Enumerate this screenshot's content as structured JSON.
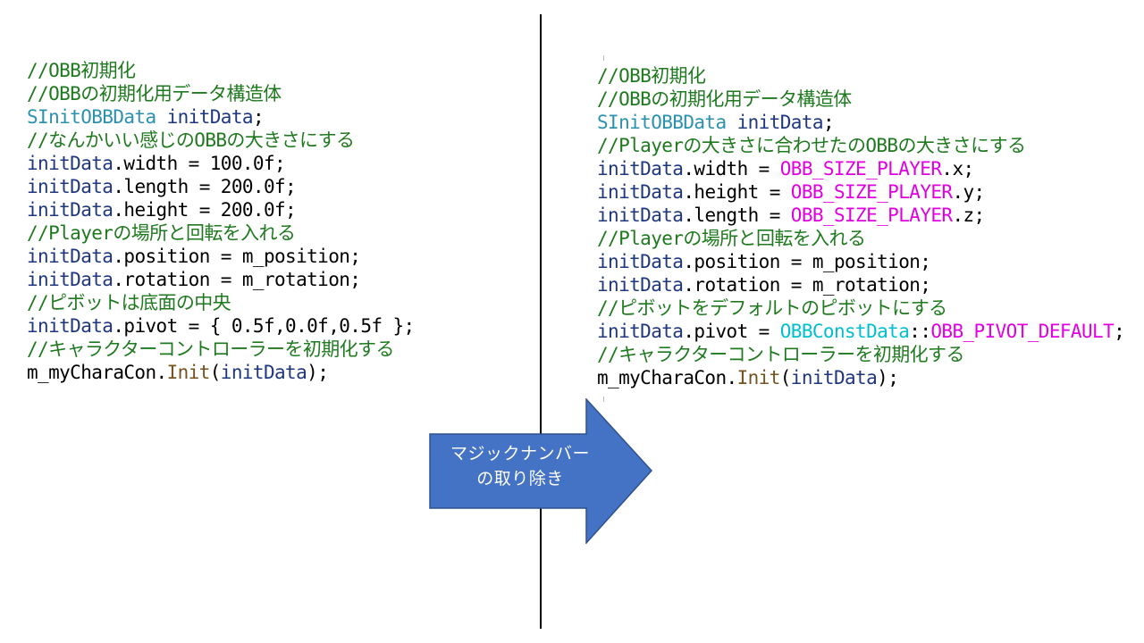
{
  "colors": {
    "comment": "#1f7a1f",
    "type": "#2b91af",
    "variable": "#1f377f",
    "macro": "#e000e0",
    "function": "#74531f",
    "namespace": "#00c0d0",
    "arrow_fill": "#4472c4",
    "arrow_stroke": "#2f528f",
    "divider": "#000000"
  },
  "arrow": {
    "line1": "マジックナンバー",
    "line2": "の取り除き"
  },
  "left": {
    "lines": [
      [
        {
          "t": "//OBB初期化",
          "c": "comment"
        }
      ],
      [
        {
          "t": "//OBBの初期化用データ構造体",
          "c": "comment"
        }
      ],
      [
        {
          "t": "SInitOBBData",
          "c": "type"
        },
        {
          "t": " ",
          "c": "plain"
        },
        {
          "t": "initData",
          "c": "var"
        },
        {
          "t": ";",
          "c": "plain"
        }
      ],
      [
        {
          "t": "//なんかいい感じのOBBの大きさにする",
          "c": "comment"
        }
      ],
      [
        {
          "t": "initData",
          "c": "var"
        },
        {
          "t": ".width = 100.0f;",
          "c": "plain"
        }
      ],
      [
        {
          "t": "initData",
          "c": "var"
        },
        {
          "t": ".length = 200.0f;",
          "c": "plain"
        }
      ],
      [
        {
          "t": "initData",
          "c": "var"
        },
        {
          "t": ".height = 200.0f;",
          "c": "plain"
        }
      ],
      [
        {
          "t": "//Playerの場所と回転を入れる",
          "c": "comment"
        }
      ],
      [
        {
          "t": "initData",
          "c": "var"
        },
        {
          "t": ".position = m_position;",
          "c": "plain"
        }
      ],
      [
        {
          "t": "initData",
          "c": "var"
        },
        {
          "t": ".rotation = m_rotation;",
          "c": "plain"
        }
      ],
      [
        {
          "t": "//ピボットは底面の中央",
          "c": "comment"
        }
      ],
      [
        {
          "t": "initData",
          "c": "var"
        },
        {
          "t": ".pivot = { 0.5f,0.0f,0.5f };",
          "c": "plain"
        }
      ],
      [
        {
          "t": "//キャラクターコントローラーを初期化する",
          "c": "comment"
        }
      ],
      [
        {
          "t": "m_myCharaCon.",
          "c": "plain"
        },
        {
          "t": "Init",
          "c": "func"
        },
        {
          "t": "(",
          "c": "plain"
        },
        {
          "t": "initData",
          "c": "var"
        },
        {
          "t": ");",
          "c": "plain"
        }
      ]
    ]
  },
  "right": {
    "lines": [
      [
        {
          "t": "//OBB初期化",
          "c": "comment"
        }
      ],
      [
        {
          "t": "//OBBの初期化用データ構造体",
          "c": "comment"
        }
      ],
      [
        {
          "t": "SInitOBBData",
          "c": "type"
        },
        {
          "t": " ",
          "c": "plain"
        },
        {
          "t": "initData",
          "c": "var"
        },
        {
          "t": ";",
          "c": "plain"
        }
      ],
      [
        {
          "t": "//Playerの大きさに合わせたのOBBの大きさにする",
          "c": "comment"
        }
      ],
      [
        {
          "t": "initData",
          "c": "var"
        },
        {
          "t": ".width = ",
          "c": "plain"
        },
        {
          "t": "OBB_SIZE_PLAYER",
          "c": "macro"
        },
        {
          "t": ".x;",
          "c": "plain"
        }
      ],
      [
        {
          "t": "initData",
          "c": "var"
        },
        {
          "t": ".height = ",
          "c": "plain"
        },
        {
          "t": "OBB_SIZE_PLAYER",
          "c": "macro"
        },
        {
          "t": ".y;",
          "c": "plain"
        }
      ],
      [
        {
          "t": "initData",
          "c": "var"
        },
        {
          "t": ".length = ",
          "c": "plain"
        },
        {
          "t": "OBB_SIZE_PLAYER",
          "c": "macro"
        },
        {
          "t": ".z;",
          "c": "plain"
        }
      ],
      [
        {
          "t": "//Playerの場所と回転を入れる",
          "c": "comment"
        }
      ],
      [
        {
          "t": "initData",
          "c": "var"
        },
        {
          "t": ".position = m_position;",
          "c": "plain"
        }
      ],
      [
        {
          "t": "initData",
          "c": "var"
        },
        {
          "t": ".rotation = m_rotation;",
          "c": "plain"
        }
      ],
      [
        {
          "t": "//ピボットをデフォルトのピボットにする",
          "c": "comment"
        }
      ],
      [
        {
          "t": "initData",
          "c": "var"
        },
        {
          "t": ".pivot = ",
          "c": "plain"
        },
        {
          "t": "OBBConstData",
          "c": "ns"
        },
        {
          "t": "::",
          "c": "plain"
        },
        {
          "t": "OBB_PIVOT_DEFAULT",
          "c": "macro"
        },
        {
          "t": ";",
          "c": "plain"
        }
      ],
      [
        {
          "t": "//キャラクターコントローラーを初期化する",
          "c": "comment"
        }
      ],
      [
        {
          "t": "m_myCharaCon.",
          "c": "plain"
        },
        {
          "t": "Init",
          "c": "func"
        },
        {
          "t": "(",
          "c": "plain"
        },
        {
          "t": "initData",
          "c": "var"
        },
        {
          "t": ");",
          "c": "plain"
        }
      ]
    ]
  }
}
